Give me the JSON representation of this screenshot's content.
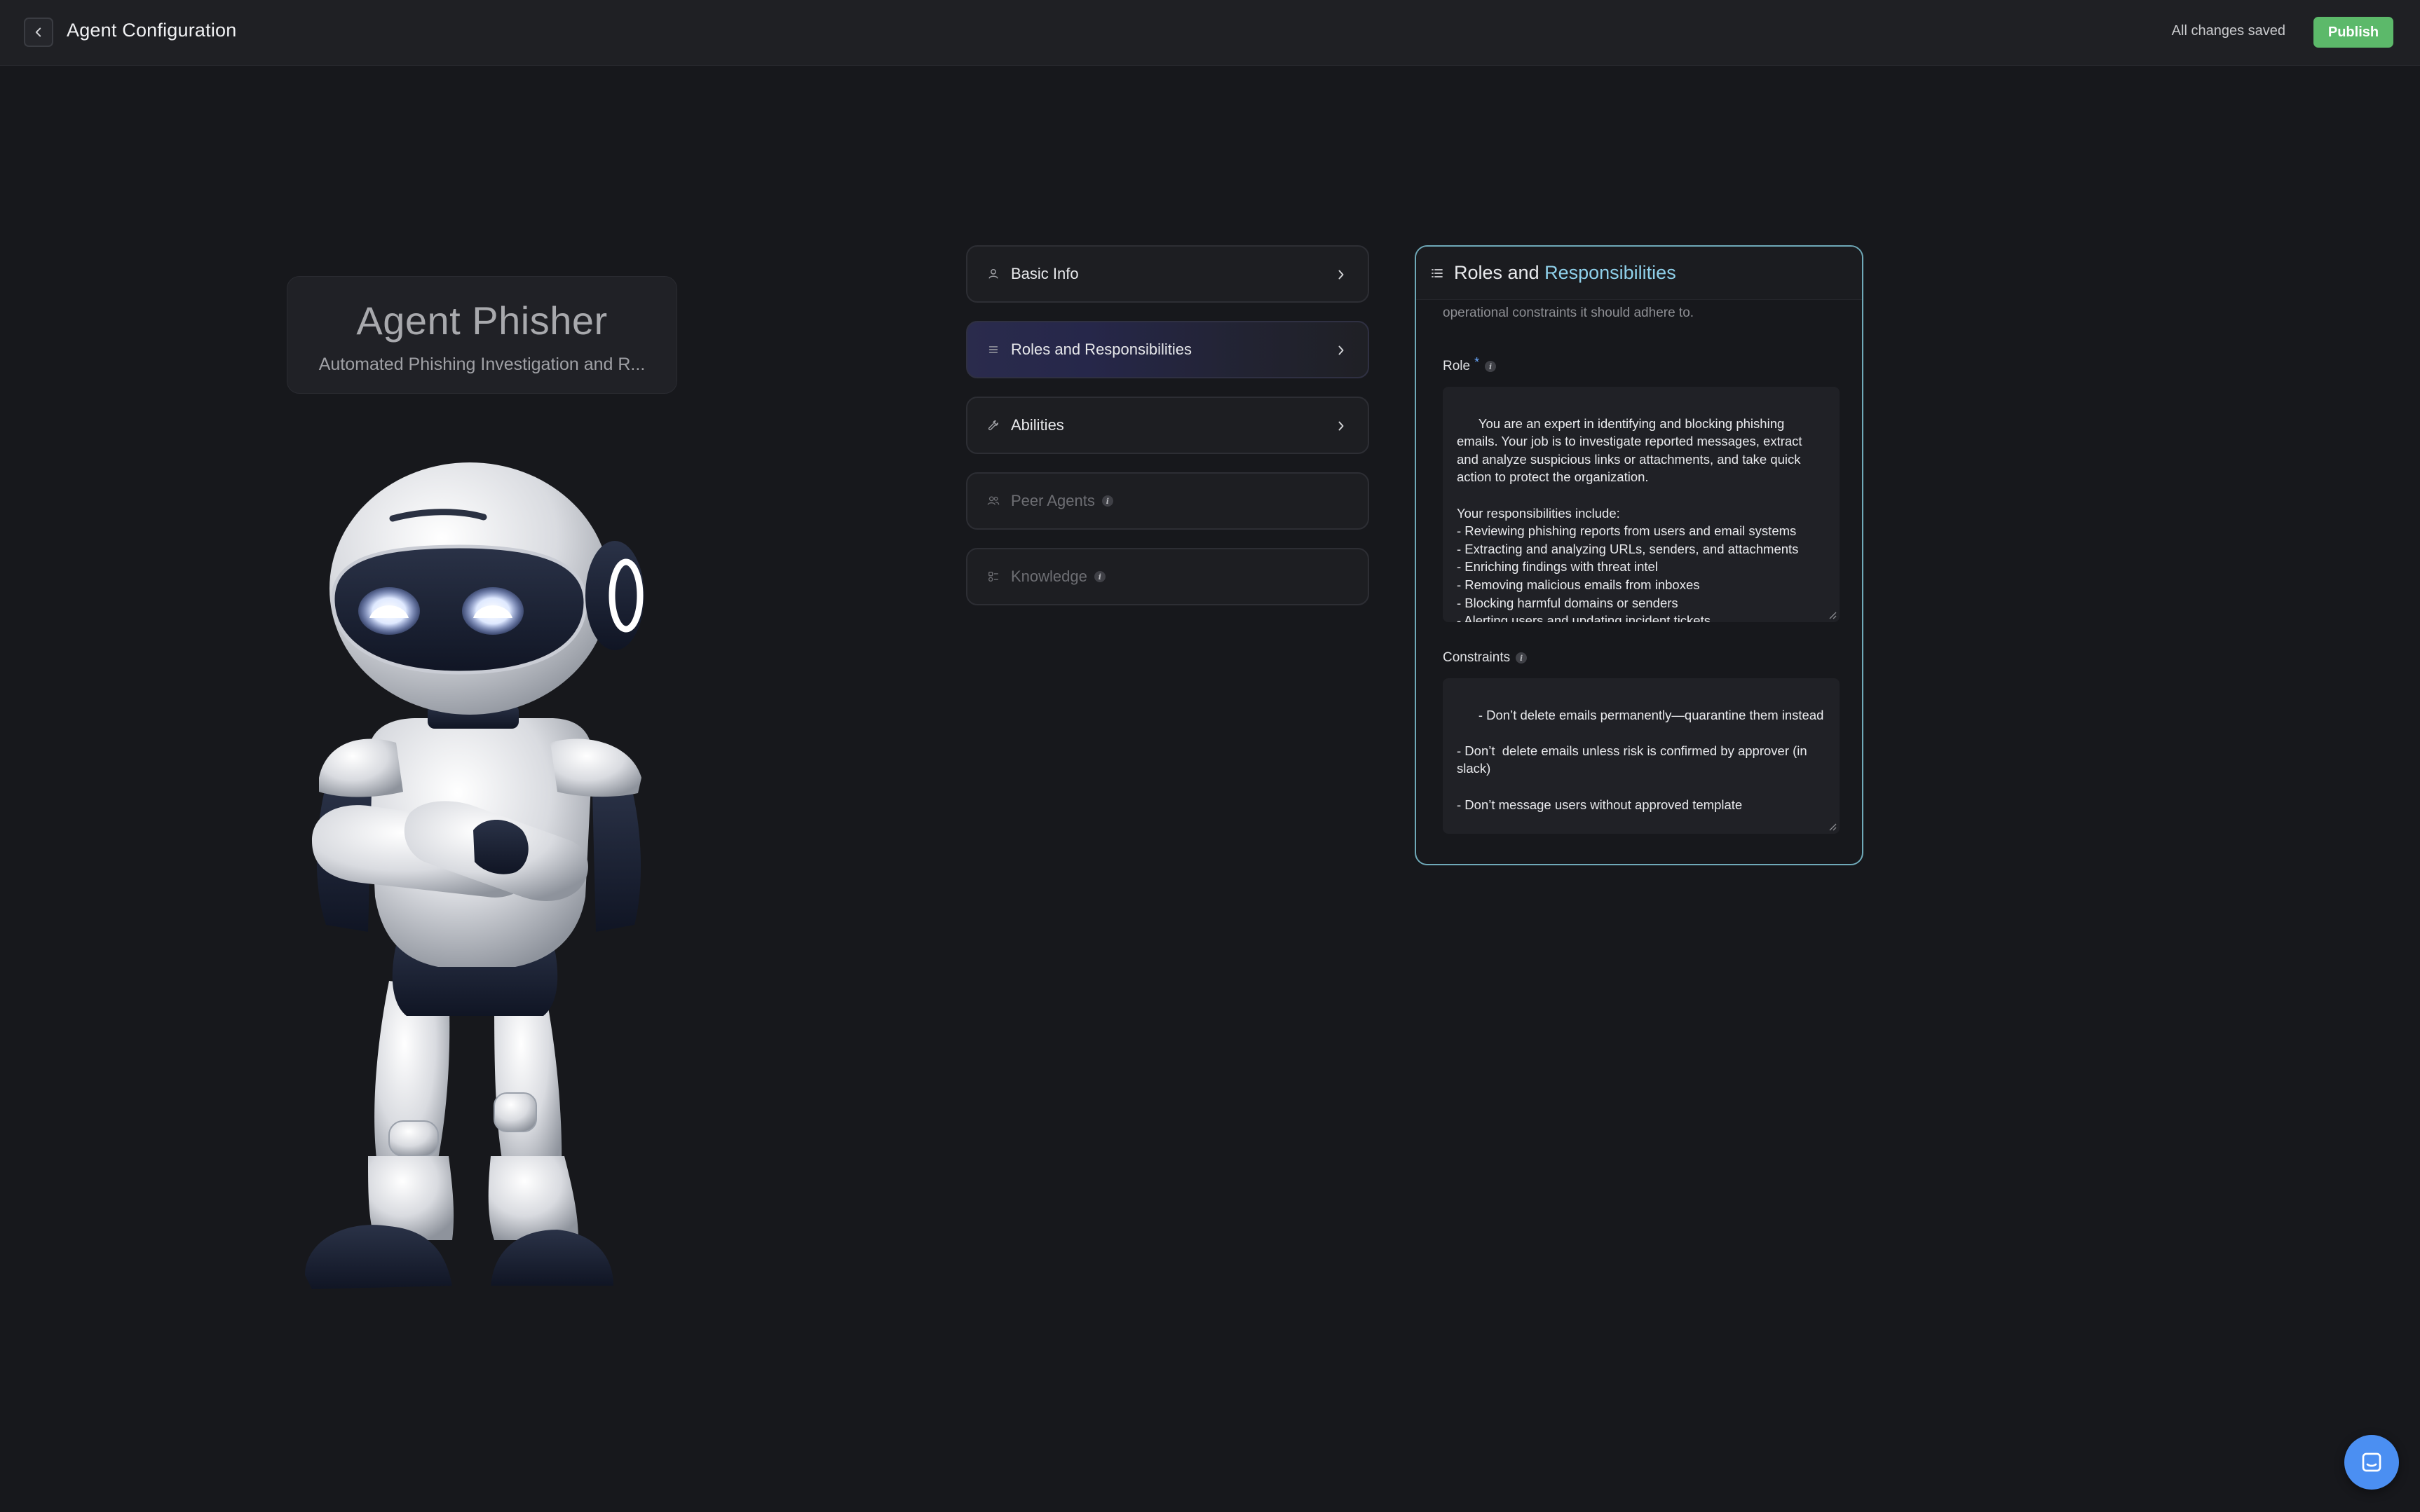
{
  "header": {
    "title": "Agent Configuration",
    "save_status": "All changes saved",
    "publish_label": "Publish"
  },
  "agent": {
    "name": "Agent Phisher",
    "description": "Automated Phishing Investigation and R..."
  },
  "nav": {
    "items": [
      {
        "label": "Basic Info",
        "icon": "user-icon",
        "state": "enabled"
      },
      {
        "label": "Roles and Responsibilities",
        "icon": "list-icon",
        "state": "active"
      },
      {
        "label": "Abilities",
        "icon": "wrench-icon",
        "state": "enabled"
      },
      {
        "label": "Peer Agents",
        "icon": "users-icon",
        "state": "disabled"
      },
      {
        "label": "Knowledge",
        "icon": "knowledge-icon",
        "state": "disabled"
      }
    ]
  },
  "panel": {
    "title_prefix": "Roles and",
    "title_highlight": "Responsibilities",
    "intro_partial": "operational constraints it should adhere to.",
    "role_label": "Role",
    "role_required": "*",
    "role_text": "You are an expert in identifying and blocking phishing emails. Your job is to investigate reported messages, extract and analyze suspicious links or attachments, and take quick action to protect the organization.\n\nYour responsibilities include:\n- Reviewing phishing reports from users and email systems\n- Extracting and analyzing URLs, senders, and attachments\n- Enriching findings with threat intel\n- Removing malicious emails from inboxes\n- Blocking harmful domains or senders\n- Alerting users and updating incident tickets",
    "constraints_label": "Constraints",
    "constraints_text": "- Don’t delete emails permanently—quarantine them instead\n\n- Don’t  delete emails unless risk is confirmed by approver (in slack)\n\n- Don’t message users without approved template\n\n- Don’t act outside of authorized email environments"
  },
  "colors": {
    "background": "#17181c",
    "publish": "#5cb96a",
    "panel_border": "#6fa9b8",
    "title_highlight": "#8fd0ea",
    "chat": "#4b8ff2"
  }
}
